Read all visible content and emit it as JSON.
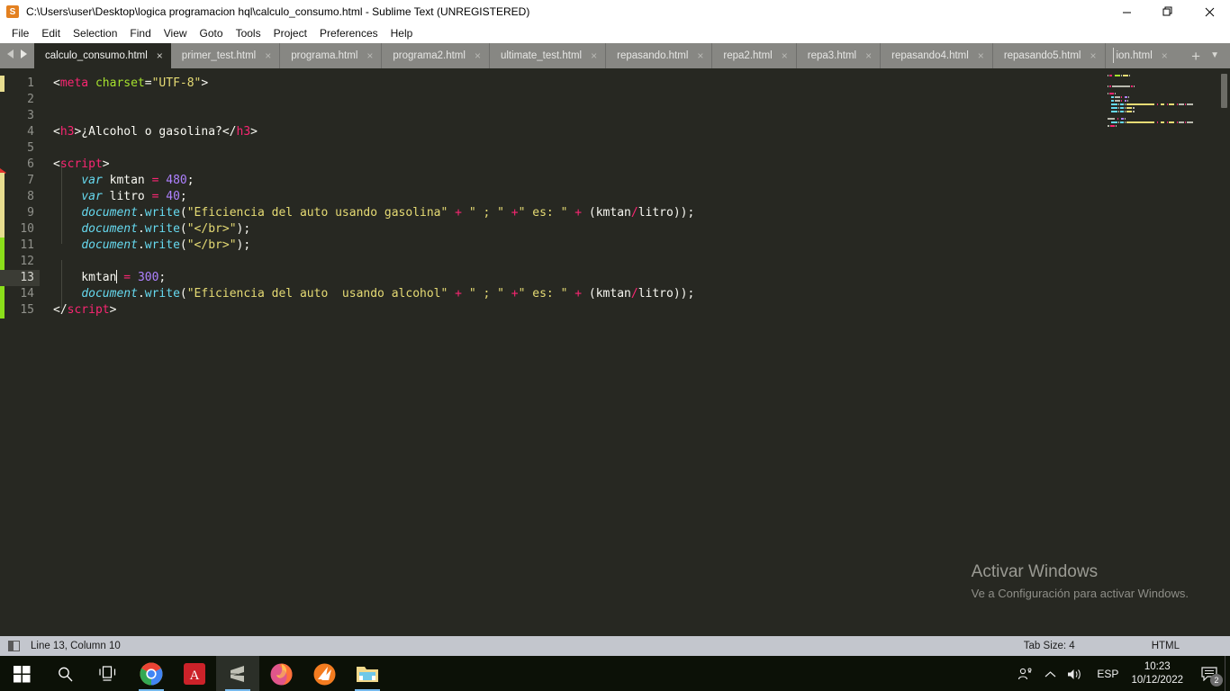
{
  "window": {
    "title": "C:\\Users\\user\\Desktop\\logica programacion hql\\calculo_consumo.html - Sublime Text (UNREGISTERED)",
    "app_icon": "sublime-text-icon",
    "controls": {
      "minimize": "minimize-icon",
      "maximize": "maximize-icon",
      "close": "close-icon"
    }
  },
  "menu": {
    "items": [
      {
        "label": "File"
      },
      {
        "label": "Edit"
      },
      {
        "label": "Selection"
      },
      {
        "label": "Find"
      },
      {
        "label": "View"
      },
      {
        "label": "Goto"
      },
      {
        "label": "Tools"
      },
      {
        "label": "Project"
      },
      {
        "label": "Preferences"
      },
      {
        "label": "Help"
      }
    ]
  },
  "tabs": {
    "nav_prev": "chevron-left-icon",
    "nav_next": "chevron-right-icon",
    "new_tab_label": "+",
    "tab_menu_label": "▼",
    "close_glyph": "×",
    "items": [
      {
        "label": "calculo_consumo.html",
        "active": true
      },
      {
        "label": "primer_test.html",
        "active": false
      },
      {
        "label": "programa.html",
        "active": false
      },
      {
        "label": "programa2.html",
        "active": false
      },
      {
        "label": "ultimate_test.html",
        "active": false
      },
      {
        "label": "repasando.html",
        "active": false
      },
      {
        "label": "repa2.html",
        "active": false
      },
      {
        "label": "repa3.html",
        "active": false
      },
      {
        "label": "repasando4.html",
        "active": false
      },
      {
        "label": "repasando5.html",
        "active": false
      },
      {
        "label": "ion.html",
        "active": false,
        "partial": true
      }
    ]
  },
  "editor": {
    "current_line": 13,
    "lines": [
      {
        "n": "1",
        "tokens": [
          {
            "t": "<",
            "c": "punct"
          },
          {
            "t": "meta",
            "c": "tag"
          },
          {
            "t": " ",
            "c": "punct"
          },
          {
            "t": "charset",
            "c": "attr"
          },
          {
            "t": "=",
            "c": "punct"
          },
          {
            "t": "\"UTF-8\"",
            "c": "str"
          },
          {
            "t": ">",
            "c": "punct"
          }
        ]
      },
      {
        "n": "2",
        "tokens": []
      },
      {
        "n": "3",
        "tokens": []
      },
      {
        "n": "4",
        "tokens": [
          {
            "t": "<",
            "c": "punct"
          },
          {
            "t": "h3",
            "c": "tag"
          },
          {
            "t": ">¿Alcohol o gasolina?</",
            "c": "punct"
          },
          {
            "t": "h3",
            "c": "tag"
          },
          {
            "t": ">",
            "c": "punct"
          }
        ]
      },
      {
        "n": "5",
        "tokens": []
      },
      {
        "n": "6",
        "tokens": [
          {
            "t": "<",
            "c": "punct"
          },
          {
            "t": "script",
            "c": "tag"
          },
          {
            "t": ">",
            "c": "punct"
          }
        ]
      },
      {
        "n": "7",
        "tokens": [
          {
            "t": "    ",
            "c": "punct"
          },
          {
            "t": "var",
            "c": "kw"
          },
          {
            "t": " kmtan ",
            "c": "var"
          },
          {
            "t": "=",
            "c": "op"
          },
          {
            "t": " ",
            "c": "punct"
          },
          {
            "t": "480",
            "c": "num"
          },
          {
            "t": ";",
            "c": "punct"
          }
        ]
      },
      {
        "n": "8",
        "tokens": [
          {
            "t": "    ",
            "c": "punct"
          },
          {
            "t": "var",
            "c": "kw"
          },
          {
            "t": " litro ",
            "c": "var"
          },
          {
            "t": "=",
            "c": "op"
          },
          {
            "t": " ",
            "c": "punct"
          },
          {
            "t": "40",
            "c": "num"
          },
          {
            "t": ";",
            "c": "punct"
          }
        ]
      },
      {
        "n": "9",
        "tokens": [
          {
            "t": "    ",
            "c": "punct"
          },
          {
            "t": "document",
            "c": "kw"
          },
          {
            "t": ".",
            "c": "punct"
          },
          {
            "t": "write",
            "c": "fn"
          },
          {
            "t": "(",
            "c": "punct"
          },
          {
            "t": "\"Eficiencia del auto usando gasolina\"",
            "c": "str"
          },
          {
            "t": " ",
            "c": "punct"
          },
          {
            "t": "+",
            "c": "op"
          },
          {
            "t": " ",
            "c": "punct"
          },
          {
            "t": "\" ; \"",
            "c": "str"
          },
          {
            "t": " ",
            "c": "punct"
          },
          {
            "t": "+",
            "c": "op"
          },
          {
            "t": "\" es: \"",
            "c": "str"
          },
          {
            "t": " ",
            "c": "punct"
          },
          {
            "t": "+",
            "c": "op"
          },
          {
            "t": " (kmtan",
            "c": "punct"
          },
          {
            "t": "/",
            "c": "op"
          },
          {
            "t": "litro));",
            "c": "punct"
          }
        ]
      },
      {
        "n": "10",
        "tokens": [
          {
            "t": "    ",
            "c": "punct"
          },
          {
            "t": "document",
            "c": "kw"
          },
          {
            "t": ".",
            "c": "punct"
          },
          {
            "t": "write",
            "c": "fn"
          },
          {
            "t": "(",
            "c": "punct"
          },
          {
            "t": "\"</br>\"",
            "c": "str"
          },
          {
            "t": ");",
            "c": "punct"
          }
        ]
      },
      {
        "n": "11",
        "tokens": [
          {
            "t": "    ",
            "c": "punct"
          },
          {
            "t": "document",
            "c": "kw"
          },
          {
            "t": ".",
            "c": "punct"
          },
          {
            "t": "write",
            "c": "fn"
          },
          {
            "t": "(",
            "c": "punct"
          },
          {
            "t": "\"</br>\"",
            "c": "str"
          },
          {
            "t": ");",
            "c": "punct"
          }
        ]
      },
      {
        "n": "12",
        "tokens": []
      },
      {
        "n": "13",
        "tokens": [
          {
            "t": "    kmtan",
            "c": "var"
          },
          {
            "t": "|CARET|",
            "c": "caret"
          },
          {
            "t": " ",
            "c": "punct"
          },
          {
            "t": "=",
            "c": "op"
          },
          {
            "t": " ",
            "c": "punct"
          },
          {
            "t": "300",
            "c": "num"
          },
          {
            "t": ";",
            "c": "punct"
          }
        ]
      },
      {
        "n": "14",
        "tokens": [
          {
            "t": "    ",
            "c": "punct"
          },
          {
            "t": "document",
            "c": "kw"
          },
          {
            "t": ".",
            "c": "punct"
          },
          {
            "t": "write",
            "c": "fn"
          },
          {
            "t": "(",
            "c": "punct"
          },
          {
            "t": "\"Eficiencia del auto  usando alcohol\"",
            "c": "str"
          },
          {
            "t": " ",
            "c": "punct"
          },
          {
            "t": "+",
            "c": "op"
          },
          {
            "t": " ",
            "c": "punct"
          },
          {
            "t": "\" ; \"",
            "c": "str"
          },
          {
            "t": " ",
            "c": "punct"
          },
          {
            "t": "+",
            "c": "op"
          },
          {
            "t": "\" es: \"",
            "c": "str"
          },
          {
            "t": " ",
            "c": "punct"
          },
          {
            "t": "+",
            "c": "op"
          },
          {
            "t": " (kmtan",
            "c": "punct"
          },
          {
            "t": "/",
            "c": "op"
          },
          {
            "t": "litro));",
            "c": "punct"
          }
        ]
      },
      {
        "n": "15",
        "tokens": [
          {
            "t": "</",
            "c": "punct"
          },
          {
            "t": "script",
            "c": "tag"
          },
          {
            "t": ">",
            "c": "punct"
          }
        ]
      }
    ],
    "gutter_marks": [
      {
        "type": "modified",
        "from_line": 1,
        "to_line": 1,
        "color": "#e7dd8f"
      },
      {
        "type": "deleted",
        "from_line": 6,
        "to_line": 6,
        "color": "#e0332e"
      },
      {
        "type": "modified",
        "from_line": 7,
        "to_line": 10,
        "color": "#e7dd8f"
      },
      {
        "type": "added",
        "from_line": 11,
        "to_line": 15,
        "color": "#8bdf1a"
      }
    ],
    "minimap": {
      "scrollbar": "minimap-scrollbar"
    }
  },
  "watermark": {
    "title": "Activar Windows",
    "subtitle": "Ve a Configuración para activar Windows."
  },
  "statusbar": {
    "sidebar_toggle_icon": "sidebar-toggle-icon",
    "cursor_position": "Line 13, Column 10",
    "tab_size": "Tab Size: 4",
    "syntax": "HTML"
  },
  "taskbar": {
    "items": [
      {
        "name": "start-button",
        "icon": "windows-logo-icon"
      },
      {
        "name": "search-button",
        "icon": "search-icon"
      },
      {
        "name": "task-view-button",
        "icon": "task-view-icon"
      },
      {
        "name": "chrome-button",
        "icon": "chrome-icon",
        "running": true
      },
      {
        "name": "acrobat-button",
        "icon": "adobe-acrobat-icon",
        "running": false
      },
      {
        "name": "sublime-button",
        "icon": "sublime-text-icon",
        "running": true,
        "active": true
      },
      {
        "name": "firefox-button",
        "icon": "firefox-icon",
        "running": false
      },
      {
        "name": "solarwinds-button",
        "icon": "orange-burst-icon",
        "running": false
      },
      {
        "name": "explorer-button",
        "icon": "file-explorer-icon",
        "running": true
      }
    ],
    "tray": {
      "meet_now_icon": "people-icon",
      "show_hidden_icon": "chevron-up-icon",
      "volume_icon": "speaker-icon",
      "language": "ESP",
      "time": "10:23",
      "date": "10/12/2022",
      "notifications_icon": "notification-icon",
      "notifications_count": "2"
    }
  },
  "colors": {
    "editor_bg": "#272822",
    "titlebar_bg": "#ffffff",
    "tabbar_bg": "#878783",
    "statusbar_bg": "#c3c6cd",
    "taskbar_bg": "#0c1107",
    "accent": "#76b9ed"
  }
}
